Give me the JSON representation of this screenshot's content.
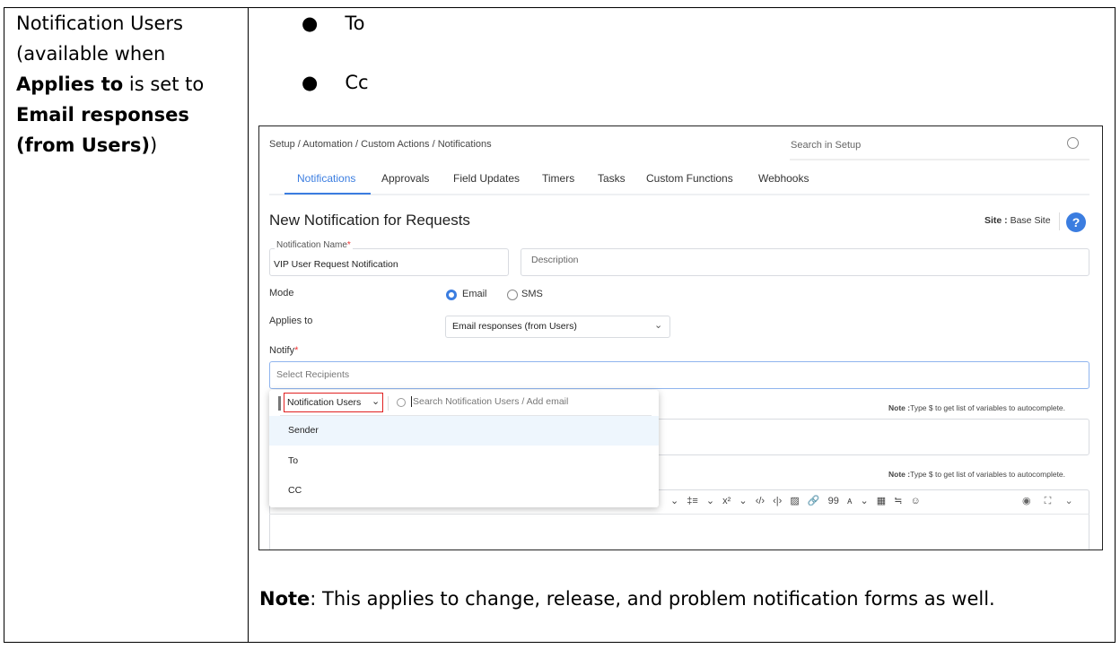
{
  "left_cell": {
    "line1": "Notification Users",
    "line2": "(available when",
    "line3_bold": "Applies to",
    "line3_rest": " is set to",
    "line4_bold": "Email responses",
    "line5_bold": "(from Users)",
    "line5_rest": ")"
  },
  "bullets": [
    "To",
    "Cc"
  ],
  "note": {
    "bold": "Note",
    "text": ": This applies to change, release, and problem notification forms as well."
  },
  "screenshot": {
    "breadcrumb": "Setup / Automation / Custom Actions / Notifications",
    "search_placeholder": "Search in Setup",
    "tabs": [
      "Notifications",
      "Approvals",
      "Field Updates",
      "Timers",
      "Tasks",
      "Custom Functions",
      "Webhooks"
    ],
    "title": "New Notification for Requests",
    "site_label": "Site :",
    "site_value": "Base Site",
    "help": "?",
    "name_label": "Notification Name",
    "required": "*",
    "name_value": "VIP User Request Notification",
    "description_placeholder": "Description",
    "mode_label": "Mode",
    "mode_options": [
      "Email",
      "SMS"
    ],
    "applies_label": "Applies to",
    "applies_value": "Email responses (from Users)",
    "notify_label": "Notify",
    "recipients_placeholder": "Select Recipients",
    "dropdown": {
      "type_value": "Notification Users",
      "search_placeholder": "Search Notification Users / Add email",
      "items": [
        "Sender",
        "To",
        "CC"
      ]
    },
    "note_bold": "Note :",
    "note_text": "Type $ to get list of variables to autocomplete.",
    "toolbar_icons": [
      "⌄",
      "‡≡",
      "⌄",
      "x²",
      "⌄",
      "‹/›",
      "‹|›",
      "▨",
      "🔗",
      "99",
      "ᴀ",
      "⌄",
      "▦",
      "≒",
      "☺"
    ],
    "toolbar_right": [
      "◉",
      "⛶",
      "⌄"
    ],
    "accent": "#3b7de0"
  }
}
